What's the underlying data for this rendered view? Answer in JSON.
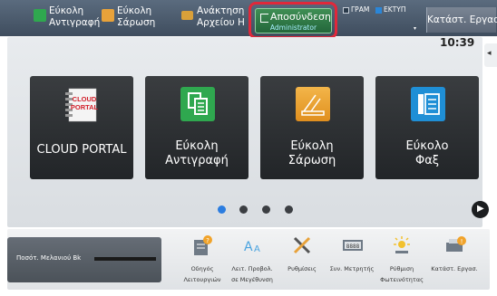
{
  "topbar": {
    "shortcuts": [
      {
        "line1": "Εύκολη",
        "line2": "Αντιγραφή",
        "icon": "copy-icon",
        "color": "#2fa84f"
      },
      {
        "line1": "Εύκολη",
        "line2": "Σάρωση",
        "icon": "scan-icon",
        "color": "#e8a23a"
      },
      {
        "line1": "Ανάκτηση",
        "line2": "Αρχείου Η",
        "icon": "folder-icon",
        "color": "#d9a03a"
      }
    ],
    "logout": {
      "label": "Αποσύνδεση",
      "user": "Administrator"
    },
    "status": [
      {
        "label": "ΓΡΑΜ",
        "color": "#2a3a4a"
      },
      {
        "label": "ΕΚΤΥΠ",
        "color": "#2a86d8"
      }
    ],
    "job_status_label": "Κατάστ. Εργασ."
  },
  "clock": "10:39",
  "tiles": [
    {
      "line1": "",
      "line2": "CLOUD PORTAL",
      "icon": "cloud-portal-icon"
    },
    {
      "line1": "Εύκολη",
      "line2": "Αντιγραφή",
      "icon": "copy-icon"
    },
    {
      "line1": "Εύκολη",
      "line2": "Σάρωση",
      "icon": "scan-icon"
    },
    {
      "line1": "Εύκολο",
      "line2": "Φαξ",
      "icon": "fax-icon"
    }
  ],
  "pager": {
    "active_index": 0,
    "count": 4,
    "active_color": "#2b7de0"
  },
  "toner": {
    "label": "Ποσότ. Μελανιού Bk"
  },
  "dock": [
    {
      "line1": "Οδηγός",
      "line2": "Λειτουργιών",
      "icon": "operation-guide-icon"
    },
    {
      "line1": "Λειτ. Προβολ.",
      "line2": "σε Μεγέθυνση",
      "icon": "enlarge-display-icon"
    },
    {
      "line1": "Ρυθμίσεις",
      "line2": "",
      "icon": "settings-icon"
    },
    {
      "line1": "Συν. Μετρητής",
      "line2": "",
      "icon": "total-count-icon"
    },
    {
      "line1": "Ρύθμιση",
      "line2": "Φωτεινότητας",
      "icon": "brightness-icon"
    },
    {
      "line1": "Κατάστ. Εργασ.",
      "line2": "",
      "icon": "job-status-icon"
    }
  ]
}
